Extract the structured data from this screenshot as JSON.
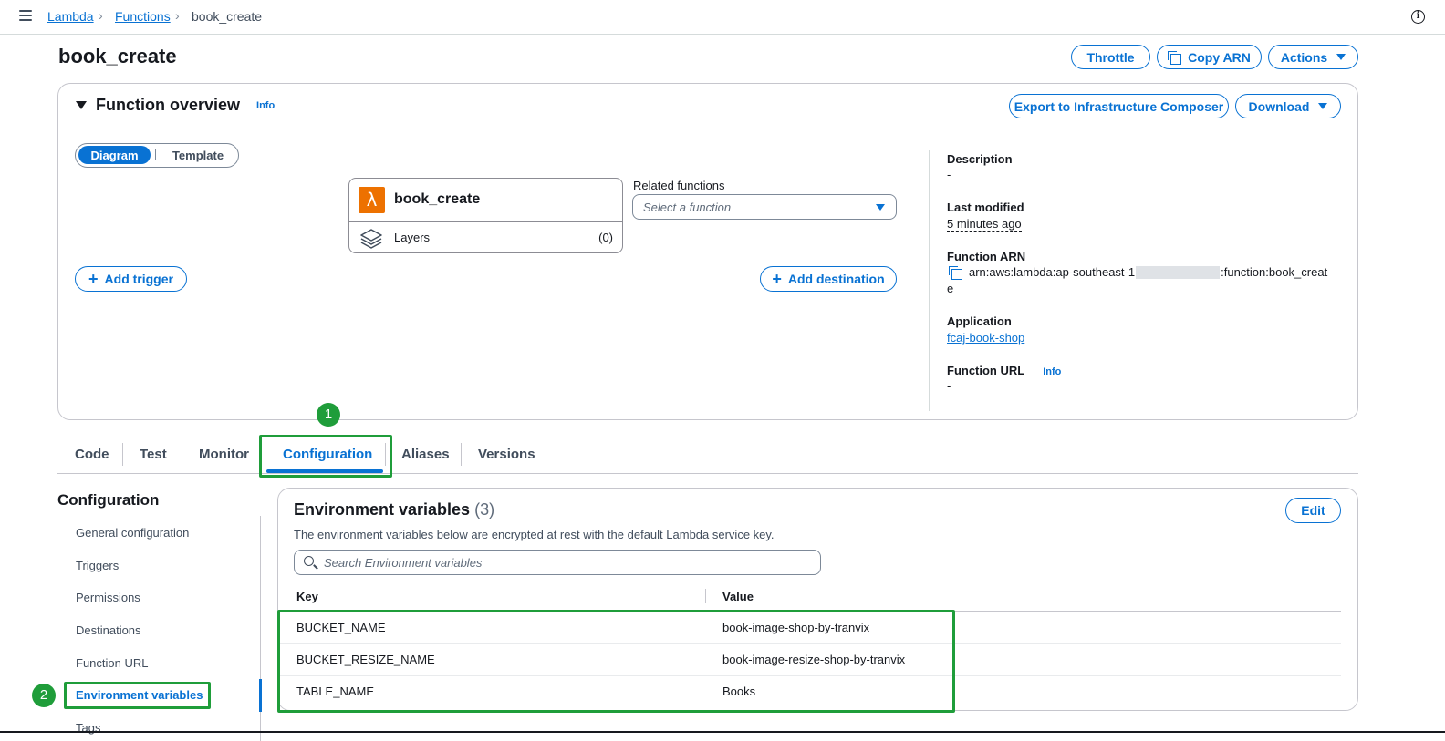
{
  "breadcrumb": {
    "root": "Lambda",
    "parent": "Functions",
    "current": "book_create"
  },
  "page_title": "book_create",
  "header_buttons": {
    "throttle": "Throttle",
    "copy_arn": "Copy ARN",
    "actions": "Actions"
  },
  "overview": {
    "title": "Function overview",
    "info": "Info",
    "export": "Export to Infrastructure Composer",
    "download": "Download",
    "view_toggle": {
      "diagram": "Diagram",
      "template": "Template"
    },
    "function_card": {
      "name": "book_create",
      "layers_label": "Layers",
      "layers_count": "(0)"
    },
    "related_functions": {
      "label": "Related functions",
      "placeholder": "Select a function"
    },
    "add_trigger": "Add trigger",
    "add_destination": "Add destination",
    "details": {
      "description_label": "Description",
      "description_value": "-",
      "last_modified_label": "Last modified",
      "last_modified_value": "5 minutes ago",
      "arn_label": "Function ARN",
      "arn_prefix": "arn:aws:lambda:ap-southeast-1",
      "arn_suffix": ":function:book_creat",
      "arn_wrap": "e",
      "application_label": "Application",
      "application_value": "fcaj-book-shop",
      "url_label": "Function URL",
      "url_info": "Info",
      "url_value": "-"
    }
  },
  "tabs": [
    "Code",
    "Test",
    "Monitor",
    "Configuration",
    "Aliases",
    "Versions"
  ],
  "annotations": {
    "step1": "1",
    "step2": "2"
  },
  "sidebar": {
    "title": "Configuration",
    "items": [
      "General configuration",
      "Triggers",
      "Permissions",
      "Destinations",
      "Function URL",
      "Environment variables",
      "Tags"
    ]
  },
  "env": {
    "title": "Environment variables",
    "count": "(3)",
    "edit": "Edit",
    "description": "The environment variables below are encrypted at rest with the default Lambda service key.",
    "search_placeholder": "Search Environment variables",
    "columns": [
      "Key",
      "Value"
    ],
    "rows": [
      {
        "key": "BUCKET_NAME",
        "value": "book-image-shop-by-tranvix"
      },
      {
        "key": "BUCKET_RESIZE_NAME",
        "value": "book-image-resize-shop-by-tranvix"
      },
      {
        "key": "TABLE_NAME",
        "value": "Books"
      }
    ]
  },
  "colors": {
    "accent": "#0972d3",
    "highlight": "#1f9d3a",
    "lambda_orange": "#ed7100"
  }
}
